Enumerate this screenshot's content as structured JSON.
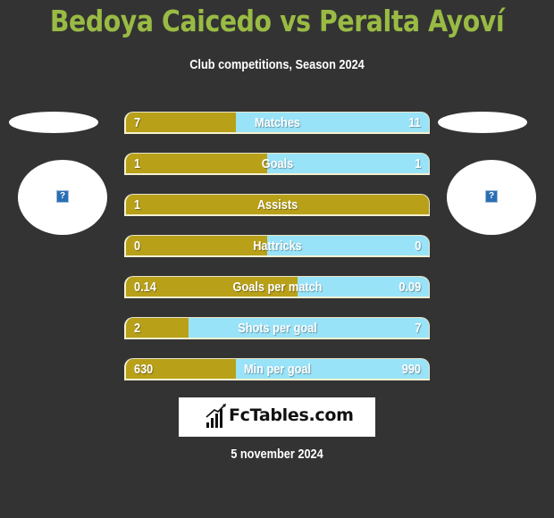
{
  "header": {
    "title": "Bedoya Caicedo vs Peralta Ayoví",
    "subtitle": "Club competitions, Season 2024"
  },
  "players": {
    "left": {
      "image_icon": "broken-image-icon",
      "icon_glyph": "?"
    },
    "right": {
      "image_icon": "broken-image-icon",
      "icon_glyph": "?"
    }
  },
  "colors": {
    "background": "#333333",
    "title": "#99bb44",
    "left_bar": "#b8a019",
    "right_bar": "#99e3f9"
  },
  "stats": [
    {
      "label": "Matches",
      "left": "7",
      "right": "11",
      "left_fraction": 0.389
    },
    {
      "label": "Goals",
      "left": "1",
      "right": "1",
      "left_fraction": 0.5
    },
    {
      "label": "Assists",
      "left": "1",
      "right": "",
      "left_fraction": 1.0
    },
    {
      "label": "Hattricks",
      "left": "0",
      "right": "0",
      "left_fraction": 0.5
    },
    {
      "label": "Goals per match",
      "left": "0.14",
      "right": "0.09",
      "left_fraction": 0.609
    },
    {
      "label": "Shots per goal",
      "left": "2",
      "right": "7",
      "left_fraction": 0.222
    },
    {
      "label": "Min per goal",
      "left": "630",
      "right": "990",
      "left_fraction": 0.389
    }
  ],
  "branding": {
    "logo_text": "FcTables.com",
    "logo_icon": "bar-chart-icon"
  },
  "footer": {
    "date": "5 november 2024"
  }
}
